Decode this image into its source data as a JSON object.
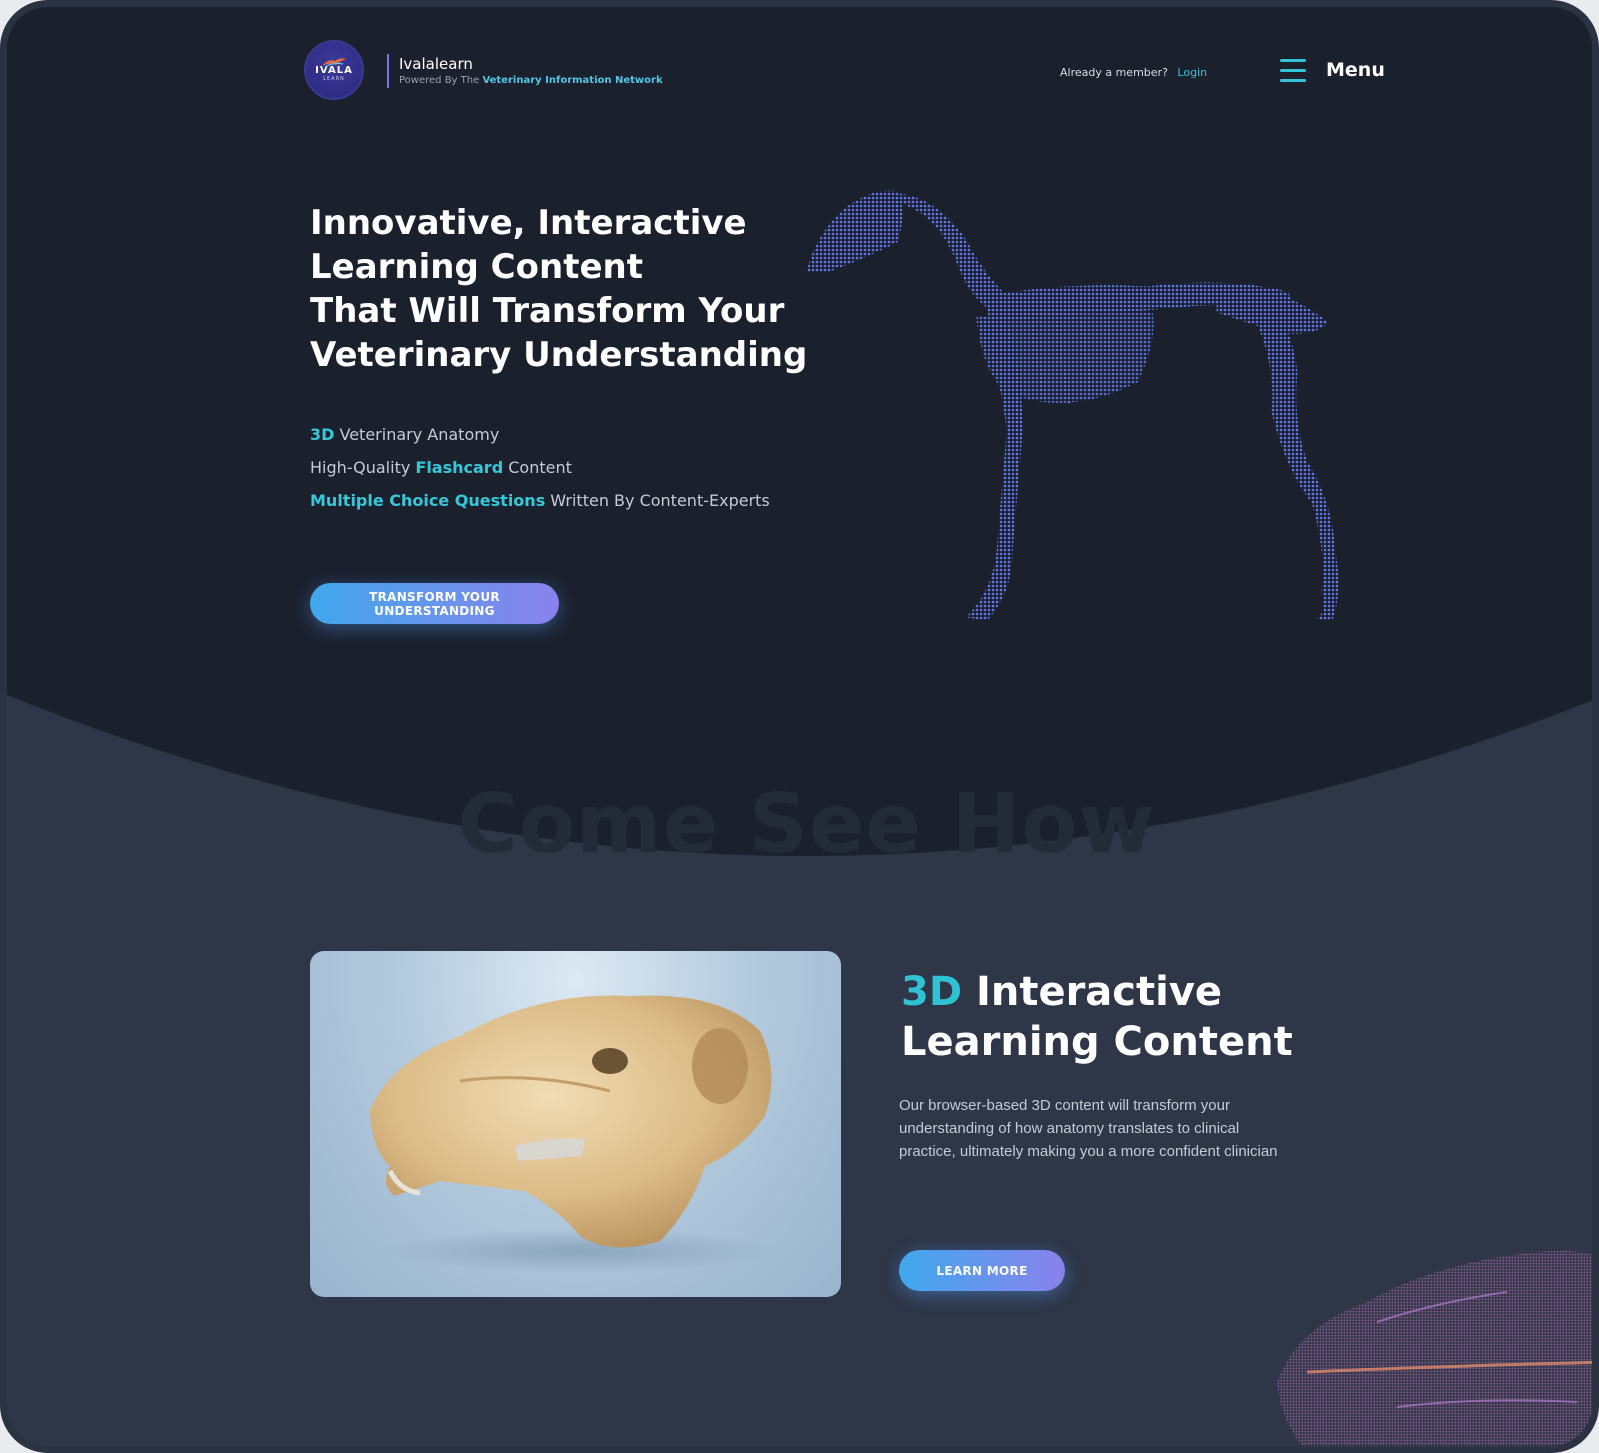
{
  "header": {
    "logo_word": "IVALA",
    "logo_sub": "LEARN",
    "brand_name": "Ivalalearn",
    "powered_prefix": "Powered By The",
    "powered_network": "Veterinary Information Network",
    "member_text": "Already a member?",
    "login_label": "Login",
    "menu_label": "Menu"
  },
  "hero": {
    "title_lines": [
      "Innovative, Interactive",
      "Learning  Content",
      "That Will Transform Your",
      "Veterinary Understanding"
    ],
    "features": [
      {
        "highlight": "3D",
        "text": " Veterinary Anatomy",
        "highlight_first": true
      },
      {
        "pre": "High-Quality ",
        "highlight": "Flashcard",
        "text": " Content"
      },
      {
        "highlight": "Multiple Choice Questions",
        "text": " Written By Content-Experts",
        "highlight_first": true
      }
    ],
    "cta_label": "TRANSFORM YOUR UNDERSTANDING"
  },
  "section": {
    "ghost_heading": "Come See How",
    "title_accent": "3D",
    "title_line1_rest": " Interactive",
    "title_line2": "Learning Content",
    "body": "Our browser-based 3D content will transform your understanding of how anatomy translates to clinical practice, ultimately making you a more confident clinician",
    "cta_label": "LEARN MORE"
  },
  "colors": {
    "hero_bg": "#1b202d",
    "section_bg": "#2e3647",
    "accent_teal": "#34c8d8",
    "button_gradient_start": "#40a8ec",
    "button_gradient_end": "#8a82ec",
    "logo_purple": "#2f2d88"
  },
  "icons": {
    "menu": "hamburger-icon",
    "horse": "horse-skeleton-illustration",
    "skull": "skull-model-image",
    "brain": "brain-dotted-illustration"
  }
}
